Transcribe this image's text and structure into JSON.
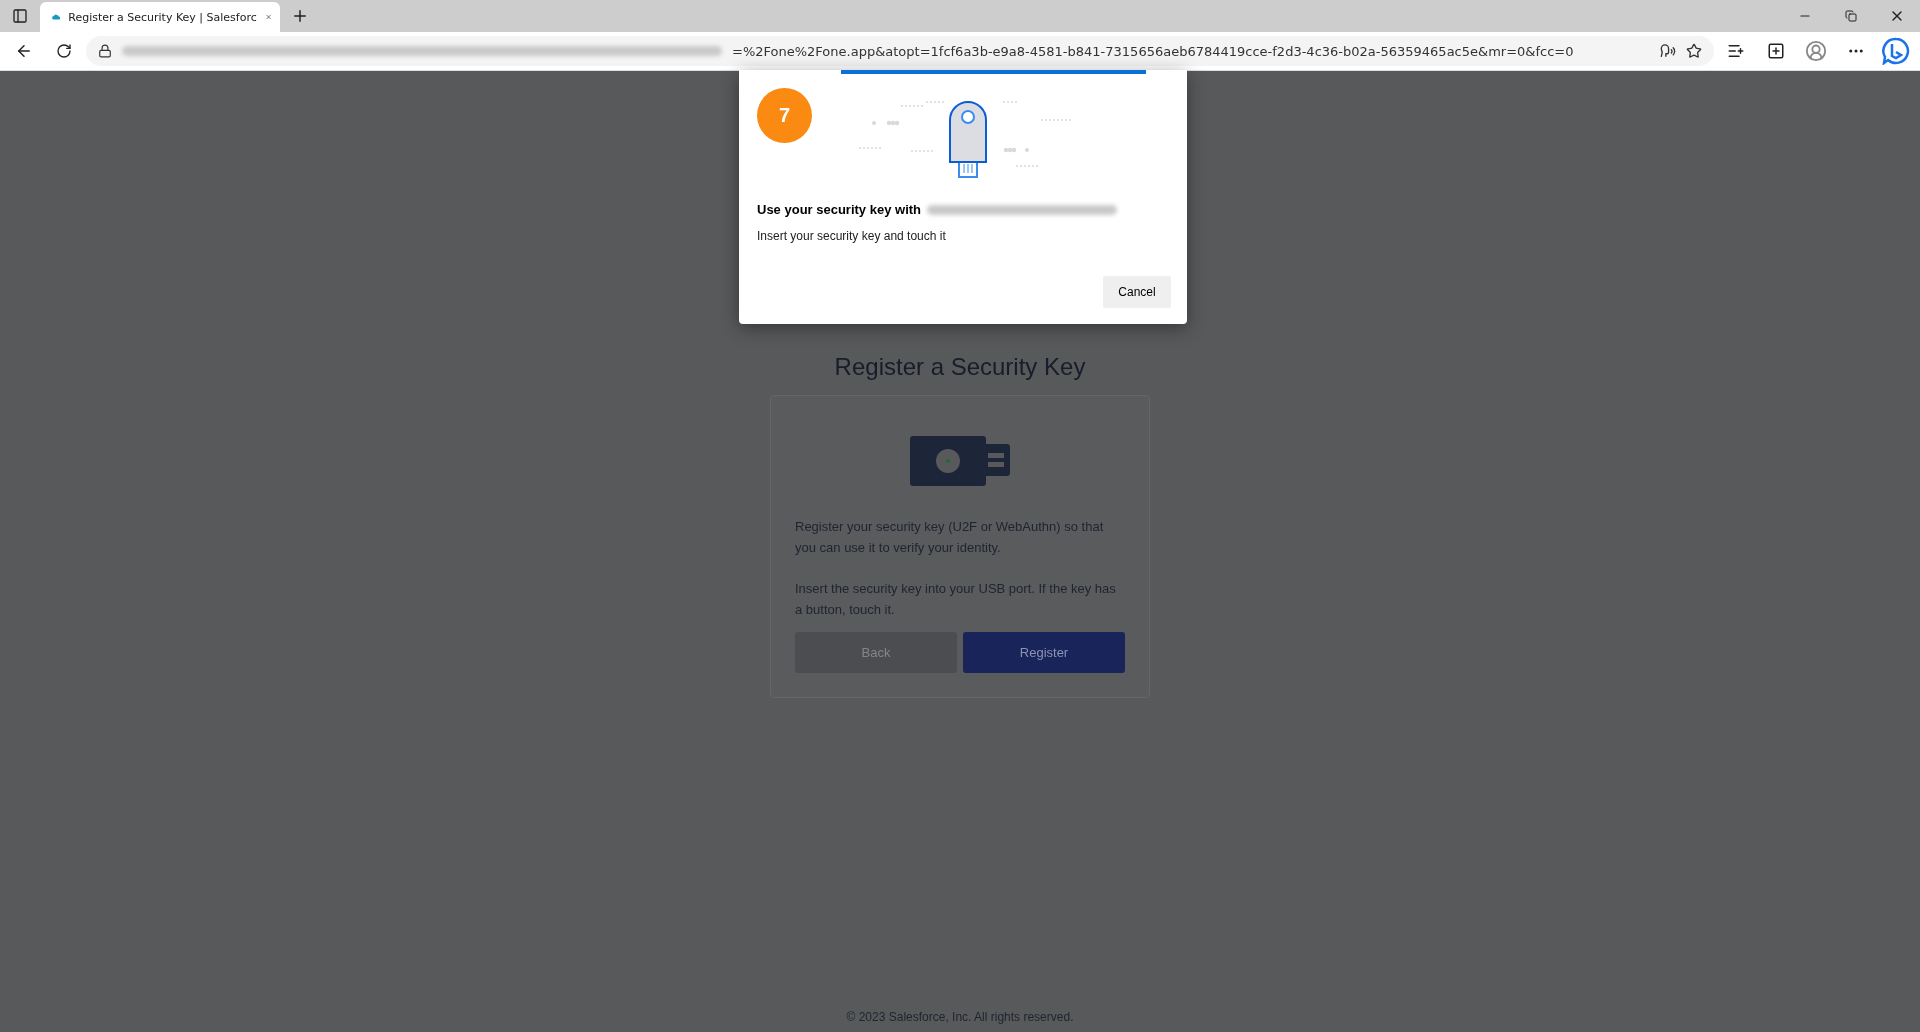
{
  "browser": {
    "tabs": [
      {
        "title": "Register a Security Key | Salesforc",
        "selected": true
      }
    ],
    "address": {
      "url_visible": "=%2Fone%2Fone.app&atopt=1fcf6a3b-e9a8-4581-b841-7315656aeb6784419cce-f2d3-4c36-b02a-56359465ac5e&mr=0&fcc=0"
    }
  },
  "dialog": {
    "badge": "7",
    "title": "Use your security key with",
    "message": "Insert your security key and touch it",
    "cancel": "Cancel"
  },
  "page": {
    "title": "Register a Security Key",
    "paragraphs": [
      "Register your security key (U2F or WebAuthn) so that you can use it to verify your identity.",
      "Insert the security key into your USB port. If the key has a button, touch it."
    ],
    "buttons": [
      {
        "label": "Back",
        "kind": "secondary",
        "disabled": true
      },
      {
        "label": "Register",
        "kind": "primary",
        "disabled": false
      }
    ],
    "footer": "© 2023 Salesforce, Inc. All rights reserved."
  }
}
